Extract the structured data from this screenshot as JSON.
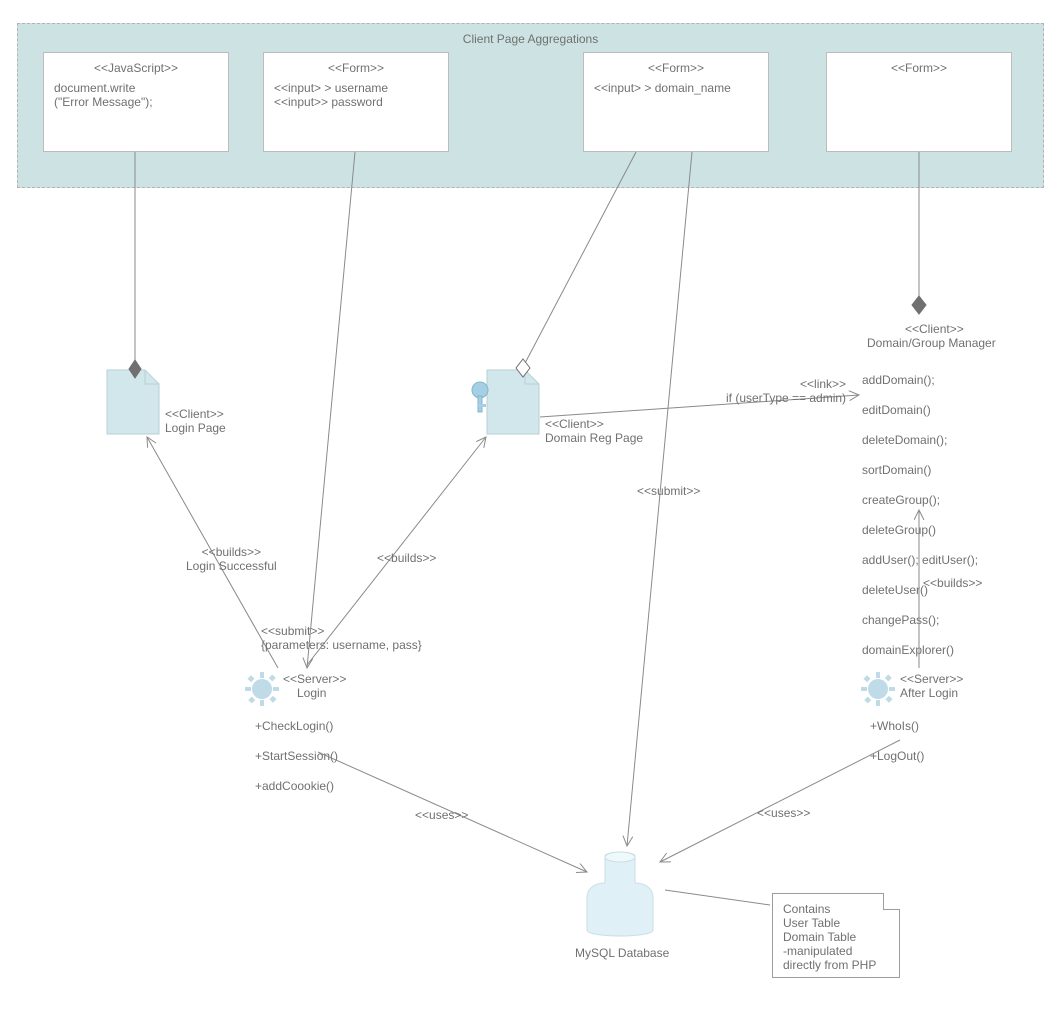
{
  "container": {
    "title": "Client Page Aggregations"
  },
  "box_js": {
    "stereotype": "<<JavaScript>>",
    "body": "document.write\n(\"Error Message\");"
  },
  "box_form_login": {
    "stereotype": "<<Form>>",
    "line1": "<<input> > username",
    "line2": "<<input>>  password"
  },
  "box_form_domain": {
    "stereotype": "<<Form>>",
    "line1": "<<input> > domain_name"
  },
  "box_form_empty": {
    "stereotype": "<<Form>>"
  },
  "login_page": {
    "stereotype": "<<Client>>",
    "name": "Login Page"
  },
  "domain_reg_page": {
    "stereotype": "<<Client>>",
    "name": "Domain Reg Page"
  },
  "domain_manager": {
    "stereotype": "<<Client>>",
    "name": "Domain/Group Manager",
    "methods": [
      "addDomain();",
      "editDomain()",
      "deleteDomain();",
      "sortDomain()",
      "createGroup();",
      "deleteGroup()",
      "addUser(); editUser();",
      "deleteUser()",
      "changePass();",
      "domainExplorer()"
    ]
  },
  "server_login": {
    "stereotype": "<<Server>>",
    "name": "Login",
    "methods": [
      "+CheckLogin()",
      "+StartSession()",
      "+addCoookie()"
    ]
  },
  "server_after_login": {
    "stereotype": "<<Server>>",
    "name": "After Login",
    "methods": [
      "+WhoIs()",
      "+LogOut()"
    ]
  },
  "database": {
    "name": "MySQL Database"
  },
  "note": {
    "line1": "Contains",
    "line2": "User Table",
    "line3": "Domain Table",
    "line4": "-manipulated",
    "line5": "directly from PHP"
  },
  "edge_labels": {
    "builds_login_success": "<<builds>>\nLogin Successful",
    "builds1": "<<builds>>",
    "builds2": "<<builds>>",
    "submit_params": "<<submit>>\n{parameters: username,  pass}",
    "submit": "<<submit>>",
    "link_admin": "<<link>>\nif (userType == admin)",
    "uses1": "<<uses>>",
    "uses2": "<<uses>>"
  }
}
